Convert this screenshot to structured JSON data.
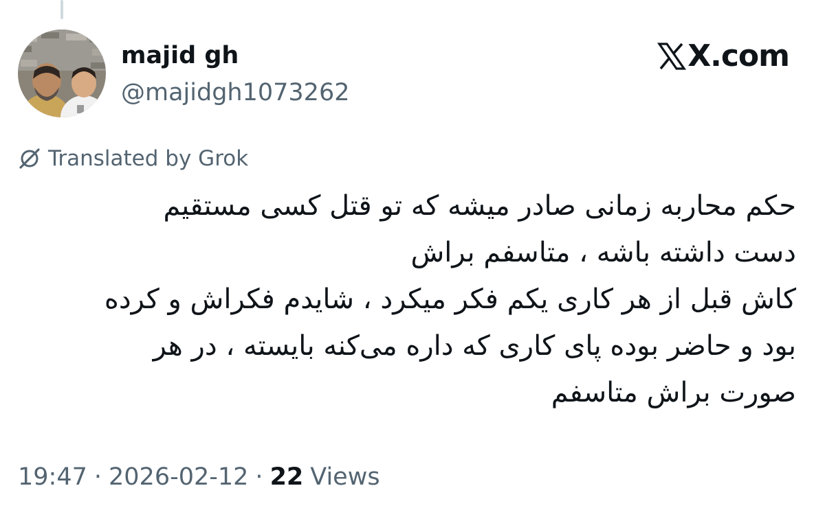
{
  "tweet": {
    "author": {
      "display_name": "majid gh",
      "handle": "@majidgh1073262",
      "avatar": "avatar-photo-two-people"
    },
    "site_label": "X.com",
    "site_logo": "x-logo-icon",
    "translation": {
      "icon": "grok-icon",
      "label": "Translated by Grok"
    },
    "text_lines": [
      "حکم محاربه زمانی صادر میشه که تو قتل کسی مستقیم",
      "دست داشته باشه ، متاسفم براش",
      "کاش قبل از هر کاری یکم فکر میکرد ، شایدم فکراش و کرده",
      "بود و حاضر بوده پای کاری که داره می‌کنه بایسته ، در هر",
      "صورت براش متاسفم"
    ],
    "time": "19:47",
    "separator": "·",
    "date": "2026-02-12",
    "views_count": "22",
    "views_label": "Views"
  },
  "colors": {
    "text_primary": "#0f1419",
    "text_secondary": "#536471",
    "thread_line": "#cfd9de",
    "background": "#ffffff"
  }
}
